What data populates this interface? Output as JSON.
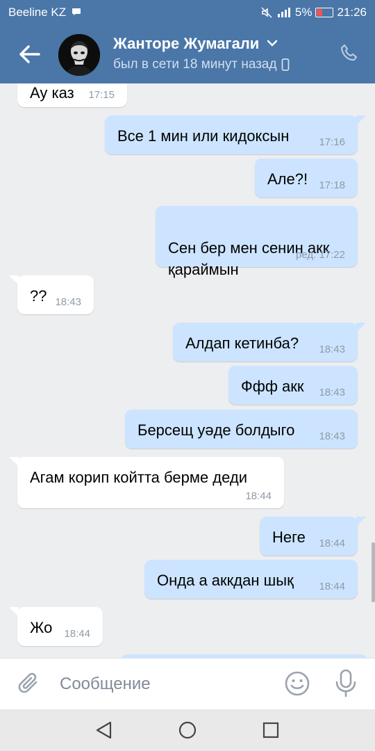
{
  "status_bar": {
    "carrier": "Beeline KZ",
    "battery": "5%",
    "time": "21:26"
  },
  "header": {
    "name": "Жанторе Жумагали",
    "status": "был в сети 18 минут назад"
  },
  "messages": [
    {
      "dir": "in",
      "text": "Ау каз",
      "time": "17:15"
    },
    {
      "dir": "out",
      "text": "Все 1 мин или кидоксын",
      "time": "17:16"
    },
    {
      "dir": "out",
      "text": "Але?!",
      "time": "17:18"
    },
    {
      "dir": "out",
      "text": "Сен бер мен сенин акк\nқараймын",
      "time": "ред. 17:22"
    },
    {
      "dir": "in",
      "text": "??",
      "time": "18:43"
    },
    {
      "dir": "out",
      "text": "Алдап кетинба?",
      "time": "18:43"
    },
    {
      "dir": "out",
      "text": "Ффф акк",
      "time": "18:43"
    },
    {
      "dir": "out",
      "text": "Берсещ уәде болдыго",
      "time": "18:43"
    },
    {
      "dir": "in",
      "text": "Агам корип койтта берме деди",
      "time": "18:44"
    },
    {
      "dir": "out",
      "text": "Неге",
      "time": "18:44"
    },
    {
      "dir": "out",
      "text": "Онда а аккдан шық",
      "time": "18:44"
    },
    {
      "dir": "in",
      "text": "Жо",
      "time": "18:44"
    },
    {
      "dir": "out",
      "text": "",
      "time": ""
    }
  ],
  "composer": {
    "placeholder": "Сообщение"
  },
  "icons": {
    "back": "arrow-left-icon",
    "avatar": "joker-avatar",
    "dropdown": "chevron-down-icon",
    "device": "mobile-device-icon",
    "call": "phone-icon",
    "attach": "paperclip-icon",
    "emoji": "smile-icon",
    "mic": "microphone-icon",
    "nav_back": "triangle-back-icon",
    "nav_home": "circle-home-icon",
    "nav_recent": "square-recent-icon"
  },
  "colors": {
    "header_bg": "#4a76a8",
    "chat_bg": "#edeef0",
    "outgoing_bubble": "#cce4ff",
    "incoming_bubble": "#ffffff",
    "time_text": "#8e9aa6"
  }
}
